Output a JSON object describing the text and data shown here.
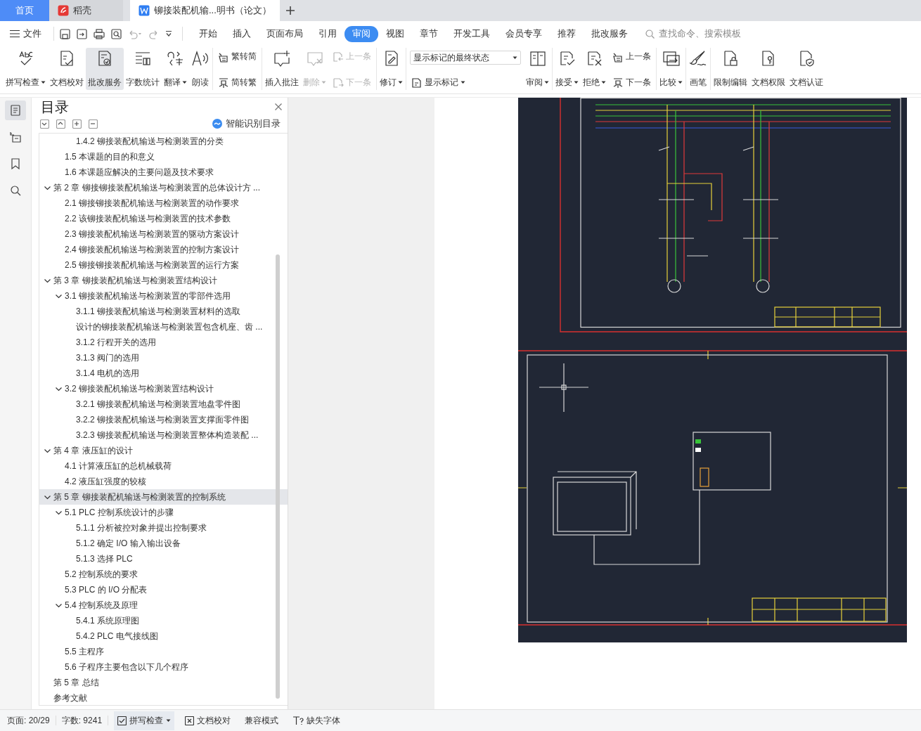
{
  "browser_tabs": [
    {
      "kind": "home",
      "label": "首页",
      "selected": false
    },
    {
      "kind": "app",
      "label": "稻壳",
      "selected": false
    },
    {
      "kind": "document",
      "label": "铆接装配机输...明书（论文）",
      "selected": true
    }
  ],
  "menu": {
    "file_label": "文件",
    "tabs": [
      {
        "label": "开始",
        "selected": false
      },
      {
        "label": "插入",
        "selected": false
      },
      {
        "label": "页面布局",
        "selected": false
      },
      {
        "label": "引用",
        "selected": false
      },
      {
        "label": "审阅",
        "selected": true
      },
      {
        "label": "视图",
        "selected": false
      },
      {
        "label": "章节",
        "selected": false
      },
      {
        "label": "开发工具",
        "selected": false
      },
      {
        "label": "会员专享",
        "selected": false
      },
      {
        "label": "推荐",
        "selected": false
      },
      {
        "label": "批改服务",
        "selected": false
      }
    ],
    "search": {
      "placeholder": "查找命令、搜索模板"
    }
  },
  "ribbon": {
    "groups": [
      {
        "items": [
          {
            "kind": "large",
            "label": "拼写检查",
            "dropdown": true,
            "disabled": false,
            "selected": false
          },
          {
            "kind": "large",
            "label": "文档校对",
            "dropdown": false,
            "disabled": false,
            "selected": false
          },
          {
            "kind": "large",
            "label": "批改服务",
            "dropdown": false,
            "disabled": false,
            "selected": true
          },
          {
            "kind": "large",
            "label": "字数统计",
            "dropdown": false,
            "disabled": false,
            "selected": false
          },
          {
            "kind": "large",
            "label": "翻译",
            "dropdown": true,
            "disabled": false,
            "selected": false
          },
          {
            "kind": "large",
            "label": "朗读",
            "dropdown": false,
            "disabled": false,
            "selected": false
          }
        ]
      },
      {
        "items": [
          {
            "kind": "pair",
            "buttons": [
              {
                "label": "繁转简",
                "disabled": false
              },
              {
                "label": "简转繁",
                "disabled": false
              }
            ]
          }
        ]
      },
      {
        "items": [
          {
            "kind": "large",
            "label": "插入批注",
            "dropdown": false,
            "disabled": false,
            "selected": false
          },
          {
            "kind": "large",
            "label": "删除",
            "dropdown": true,
            "disabled": true,
            "selected": false
          },
          {
            "kind": "pair",
            "buttons": [
              {
                "label": "上一条",
                "disabled": true
              },
              {
                "label": "下一条",
                "disabled": true
              }
            ]
          }
        ]
      },
      {
        "items": [
          {
            "kind": "large",
            "label": "修订",
            "dropdown": true,
            "disabled": false,
            "selected": false
          }
        ]
      },
      {
        "items": [
          {
            "kind": "select",
            "value": "显示标记的最终状态",
            "button": {
              "label": "显示标记",
              "disabled": false
            }
          },
          {
            "kind": "large",
            "label": "审阅",
            "dropdown": true,
            "disabled": false,
            "selected": false
          }
        ]
      },
      {
        "items": [
          {
            "kind": "large",
            "label": "接受",
            "dropdown": true,
            "disabled": false,
            "selected": false
          },
          {
            "kind": "large",
            "label": "拒绝",
            "dropdown": true,
            "disabled": false,
            "selected": false
          },
          {
            "kind": "pair",
            "buttons": [
              {
                "label": "上一条",
                "disabled": false
              },
              {
                "label": "下一条",
                "disabled": false
              }
            ]
          }
        ]
      },
      {
        "items": [
          {
            "kind": "large",
            "label": "比较",
            "dropdown": true,
            "disabled": false,
            "selected": false
          }
        ]
      },
      {
        "items": [
          {
            "kind": "large",
            "label": "画笔",
            "dropdown": false,
            "disabled": false,
            "selected": false
          }
        ]
      },
      {
        "items": [
          {
            "kind": "large",
            "label": "限制编辑",
            "dropdown": false,
            "disabled": false,
            "selected": false
          },
          {
            "kind": "large",
            "label": "文档权限",
            "dropdown": false,
            "disabled": false,
            "selected": false
          },
          {
            "kind": "large",
            "label": "文档认证",
            "dropdown": false,
            "disabled": false,
            "selected": false
          }
        ]
      }
    ]
  },
  "side_strip": [
    {
      "selected": true
    },
    {
      "selected": false
    },
    {
      "selected": false
    },
    {
      "selected": false
    }
  ],
  "toc": {
    "title": "目录",
    "smart_label": "智能识别目录",
    "items": [
      {
        "children": [
          {
            "children": [
              {
                "label": "1.4.2 铆接装配机输送与检测装置的分类",
                "selected": false
              }
            ]
          },
          {
            "label": "1.5 本课题的目的和意义",
            "selected": false
          },
          {
            "label": "1.6 本课题应解决的主要问题及技术要求",
            "selected": false
          }
        ]
      },
      {
        "label": "第 2 章 铆接铆接装配机输送与检测装置的总体设计方 ...",
        "selected": false,
        "expanded": true,
        "children": [
          {
            "label": "2.1 铆接铆接装配机输送与检测装置的动作要求",
            "selected": false
          },
          {
            "label": "2.2 该铆接装配机输送与检测装置的技术参数",
            "selected": false
          },
          {
            "label": "2.3 铆接装配机输送与检测装置的驱动方案设计",
            "selected": false
          },
          {
            "label": "2.4 铆接装配机输送与检测装置的控制方案设计",
            "selected": false
          },
          {
            "label": "2.5 铆接铆接装配机输送与检测装置的运行方案",
            "selected": false
          }
        ]
      },
      {
        "label": "第 3 章 铆接装配机输送与检测装置结构设计",
        "selected": false,
        "expanded": true,
        "children": [
          {
            "label": "3.1 铆接装配机输送与检测装置的零部件选用",
            "selected": false,
            "expanded": true,
            "children": [
              {
                "label": "3.1.1 铆接装配机输送与检测装置材料的选取",
                "selected": false
              },
              {
                "label": "设计的铆接装配机输送与检测装置包含机座、齿 ...",
                "selected": false
              },
              {
                "label": "3.1.2 行程开关的选用",
                "selected": false
              },
              {
                "label": "3.1.3 阀门的选用",
                "selected": false
              },
              {
                "label": "3.1.4 电机的选用",
                "selected": false
              }
            ]
          },
          {
            "label": "3.2 铆接装配机输送与检测装置结构设计",
            "selected": false,
            "expanded": true,
            "children": [
              {
                "label": "3.2.1 铆接装配机输送与检测装置地盘零件图",
                "selected": false
              },
              {
                "label": "3.2.2 铆接装配机输送与检测装置支撑面零件图",
                "selected": false
              },
              {
                "label": "3.2.3 铆接装配机输送与检测装置整体构造装配 ...",
                "selected": false
              }
            ]
          }
        ]
      },
      {
        "label": "第 4 章 液压缸的设计",
        "selected": false,
        "expanded": true,
        "children": [
          {
            "label": "4.1 计算液压缸的总机械载荷",
            "selected": false
          },
          {
            "label": "4.2 液压缸强度的较核",
            "selected": false
          }
        ]
      },
      {
        "label": "第 5 章 铆接装配机输送与检测装置的控制系统",
        "selected": true,
        "expanded": true,
        "children": [
          {
            "label": "5.1 PLC 控制系统设计的步骤",
            "selected": false,
            "expanded": true,
            "children": [
              {
                "label": "5.1.1 分析被控对象并提出控制要求",
                "selected": false
              },
              {
                "label": "5.1.2 确定 I/O 输入输出设备",
                "selected": false
              },
              {
                "label": "5.1.3 选择 PLC",
                "selected": false
              }
            ]
          },
          {
            "label": "5.2 控制系统的要求",
            "selected": false
          },
          {
            "label": "5.3 PLC 的 I/O 分配表",
            "selected": false
          },
          {
            "label": "5.4 控制系统及原理",
            "selected": false,
            "expanded": true,
            "children": [
              {
                "label": "5.4.1 系统原理图",
                "selected": false
              },
              {
                "label": "5.4.2 PLC 电气接线图",
                "selected": false
              }
            ]
          },
          {
            "label": "5.5 主程序",
            "selected": false
          },
          {
            "label": "5.6 子程序主要包含以下几个程序",
            "selected": false
          }
        ]
      },
      {
        "label": "第 5 章 总结",
        "selected": false
      },
      {
        "label": "参考文献",
        "selected": false
      }
    ]
  },
  "status_bar": {
    "page": "页面: 20/29",
    "words": "字数: 9241",
    "spell_check": {
      "label": "拼写检查",
      "selected": true
    },
    "proofread": "文档校对",
    "compat_mode": "兼容模式",
    "missing_fonts": "缺失字体"
  }
}
